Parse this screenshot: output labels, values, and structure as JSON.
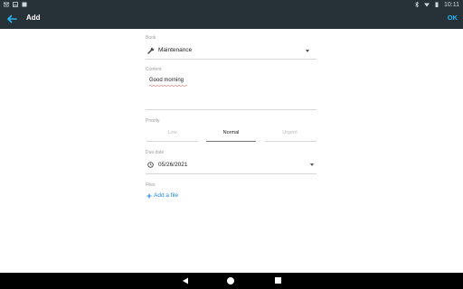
{
  "status_bar": {
    "time": "10:11",
    "left_icons": [
      "gmail-icon",
      "photo-icon",
      "notification-icon"
    ],
    "right_icons": [
      "bluetooth-icon",
      "wifi-icon",
      "battery-icon"
    ]
  },
  "app_bar": {
    "title": "Add",
    "back_icon": "arrow-back-icon",
    "confirm_label": "OK",
    "accent_color": "#29b6f6",
    "background_color": "#263238"
  },
  "form": {
    "book": {
      "label": "Book",
      "value": "Maintenance",
      "icon": "wrench-icon"
    },
    "content": {
      "label": "Content",
      "value": "Good morning"
    },
    "priority": {
      "label": "Priority",
      "options": [
        "Low",
        "Normal",
        "Urgent"
      ],
      "selected": "Normal"
    },
    "due_date": {
      "label": "Due date",
      "value": "05/26/2021",
      "icon": "clock-icon"
    },
    "files": {
      "label": "Files",
      "add_label": "Add a file",
      "add_icon": "plus-icon"
    }
  },
  "nav_bar": {
    "icons": [
      "nav-back-icon",
      "nav-home-icon",
      "nav-recents-icon"
    ]
  }
}
